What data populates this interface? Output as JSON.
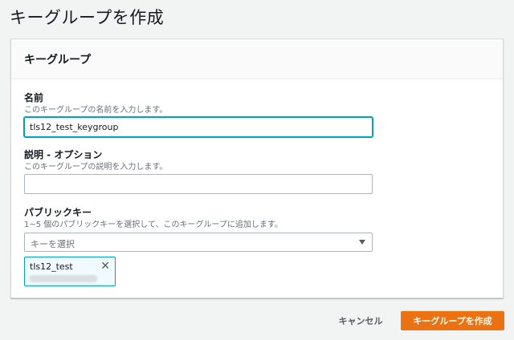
{
  "page": {
    "title": "キーグループを作成"
  },
  "panel": {
    "header": "キーグループ"
  },
  "name_field": {
    "label": "名前",
    "description": "このキーグループの名前を入力します。",
    "value": "tls12_test_keygroup"
  },
  "description_field": {
    "label": "説明 - オプション",
    "description": "このキーグループの説明を入力します。",
    "value": ""
  },
  "public_key_field": {
    "label": "パブリックキー",
    "description": "1~5 個のパブリックキーを選択して、このキーグループに追加します。",
    "select_placeholder": "キーを選択",
    "selected_tokens": [
      {
        "name": "tls12_test"
      }
    ]
  },
  "actions": {
    "cancel": "キャンセル",
    "create": "キーグループを作成"
  },
  "colors": {
    "primary": "#ec7211",
    "focus": "#00a1c9"
  },
  "icons": {
    "dropdown": "caret-down-icon",
    "remove_token": "close-icon"
  }
}
